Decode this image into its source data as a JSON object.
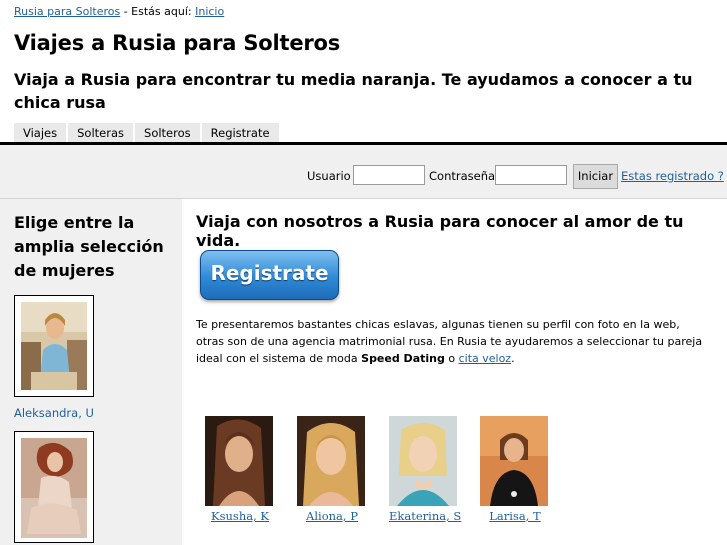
{
  "breadcrumb": {
    "home_link": "Rusia para Solteros",
    "separator": " - Estás aquí: ",
    "current": "Inicio"
  },
  "header": {
    "title": "Viajes a Rusia para Solteros",
    "tagline": "Viaja a Rusia para encontrar tu media naranja. Te ayudamos a conocer a tu chica rusa"
  },
  "nav": {
    "tabs": [
      {
        "label": "Viajes"
      },
      {
        "label": "Solteras"
      },
      {
        "label": "Solteros"
      },
      {
        "label": "Registrate"
      }
    ]
  },
  "login": {
    "user_label": "Usuario",
    "user_value": "",
    "pass_label": "Contraseña",
    "pass_value": "",
    "submit_label": "Iniciar",
    "register_link": "Estas registrado ?"
  },
  "sidebar": {
    "title": "Elige entre la amplia selección de mujeres",
    "profiles": [
      {
        "name": "Aleksandra, U"
      },
      {
        "name": ""
      }
    ]
  },
  "main": {
    "title": "Viaja con nosotros a Rusia para conocer al amor de tu vida.",
    "register_button": "Registrate",
    "intro_part1": "Te presentaremos bastantes chicas eslavas, algunas tienen su perfil con foto en la web, otras son de una agencia matrimonial rusa. En Rusia te ayudaremos a seleccionar tu pareja ideal con el sistema de moda ",
    "intro_bold": "Speed Dating",
    "intro_part2": " o ",
    "intro_link": "cita veloz",
    "intro_end": ".",
    "girls": [
      {
        "name": "Ksusha, K"
      },
      {
        "name": "Aliona, P"
      },
      {
        "name": "Ekaterina, S"
      },
      {
        "name": "Larisa, T"
      }
    ]
  },
  "colors": {
    "link": "#1f5f9e",
    "sidebar_bg": "#f0f0f0",
    "tab_bg": "#e9e9e9",
    "button_blue": "#2f8ad6"
  }
}
